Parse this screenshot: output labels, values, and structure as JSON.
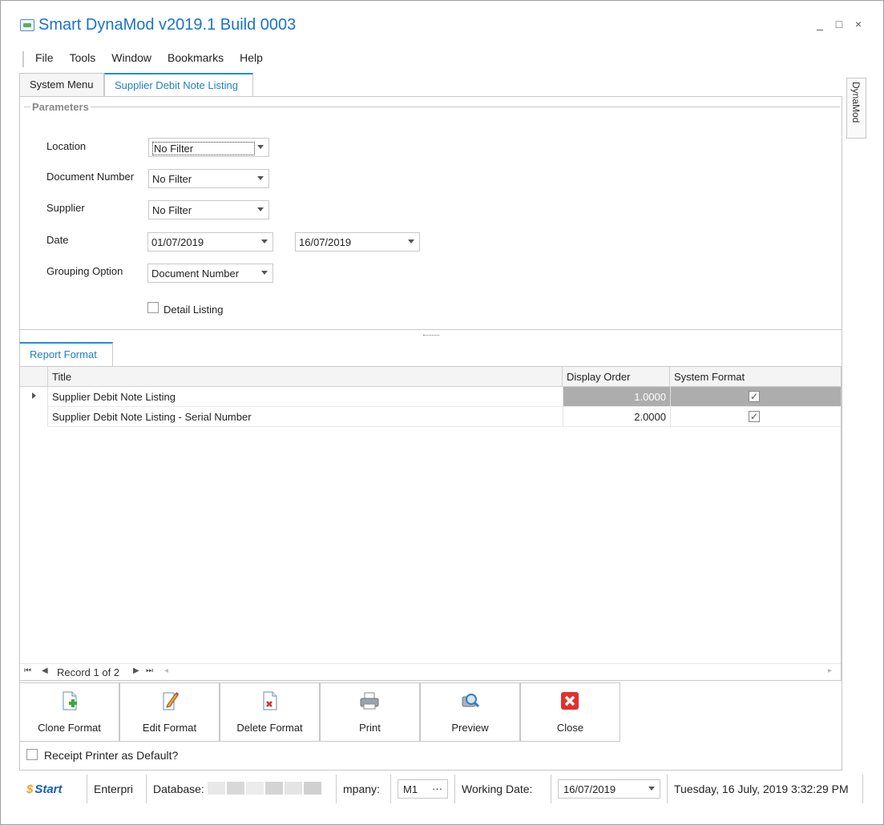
{
  "window": {
    "title": "Smart DynaMod v2019.1 Build 0003",
    "controls": [
      "_",
      "□",
      "×"
    ]
  },
  "menu": [
    "File",
    "Tools",
    "Window",
    "Bookmarks",
    "Help"
  ],
  "tabs": [
    {
      "label": "System Menu",
      "active": false
    },
    {
      "label": "Supplier Debit Note Listing",
      "active": true
    }
  ],
  "side_tab": "DynaMod",
  "parameters": {
    "legend": "Parameters",
    "location": {
      "label": "Location",
      "value": "No Filter"
    },
    "document_number": {
      "label": "Document Number",
      "value": "No Filter"
    },
    "supplier": {
      "label": "Supplier",
      "value": "No Filter"
    },
    "date": {
      "label": "Date",
      "from": "01/07/2019",
      "to": "16/07/2019"
    },
    "grouping": {
      "label": "Grouping Option",
      "value": "Document Number"
    },
    "detail_listing": {
      "label": "Detail Listing",
      "checked": false
    }
  },
  "report_format": {
    "tab_label": "Report Format",
    "columns": [
      "Title",
      "Display Order",
      "System Format"
    ],
    "rows": [
      {
        "title": "Supplier Debit Note Listing",
        "display_order": "1.0000",
        "system_format": true,
        "selected": true
      },
      {
        "title": "Supplier Debit Note Listing - Serial Number",
        "display_order": "2.0000",
        "system_format": true,
        "selected": false
      }
    ],
    "navigator": "Record 1 of 2"
  },
  "buttons": [
    {
      "label": "Clone Format",
      "icon": "clone-format-icon"
    },
    {
      "label": "Edit Format",
      "icon": "edit-format-icon"
    },
    {
      "label": "Delete Format",
      "icon": "delete-format-icon"
    },
    {
      "label": "Print",
      "icon": "printer-icon"
    },
    {
      "label": "Preview",
      "icon": "preview-icon"
    },
    {
      "label": "Close",
      "icon": "close-icon"
    }
  ],
  "receipt_printer": {
    "label": "Receipt Printer as Default?",
    "checked": false
  },
  "status": {
    "brand": "Start",
    "edition": "Enterpri",
    "database_label": "Database:",
    "company_label": "mpany:",
    "company_value": "M1",
    "company_ellipsis": "···",
    "working_date_label": "Working Date:",
    "working_date": "16/07/2019",
    "datetime": "Tuesday, 16 July, 2019 3:32:29 PM"
  },
  "colors": {
    "accent": "#1e8fd8",
    "title": "#1a73c8",
    "selected_row": "#adadad",
    "close_red": "#e0322b"
  }
}
